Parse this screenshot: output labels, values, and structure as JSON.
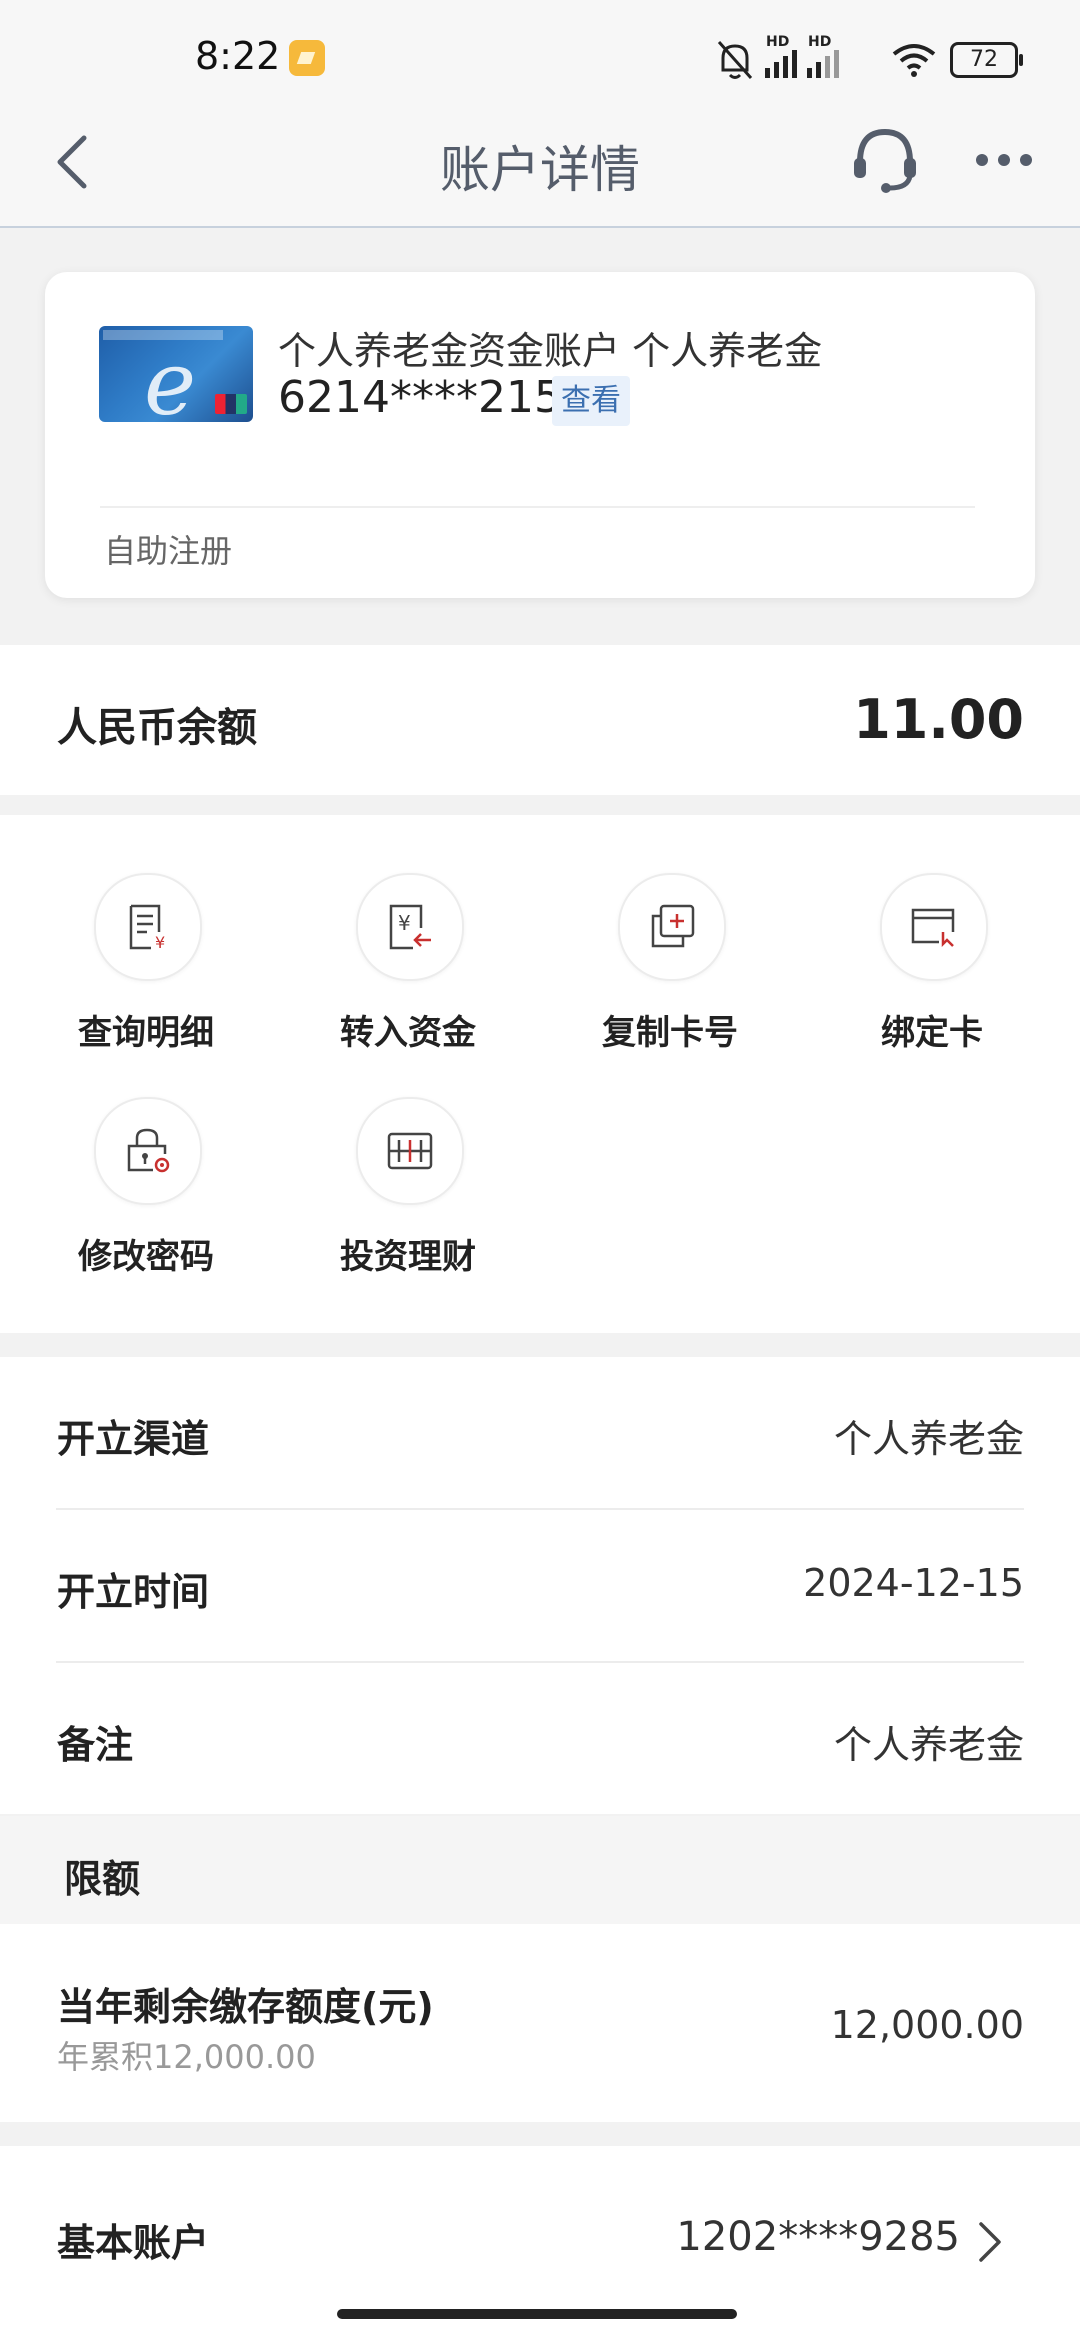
{
  "status_bar": {
    "time": "8:22",
    "battery": "72",
    "hd1": "HD",
    "hd2": "HD"
  },
  "nav": {
    "title": "账户详情"
  },
  "card": {
    "account_name": "个人养老金资金账户 个人养老金",
    "account_number": "6214****2157",
    "view_label": "查看",
    "registration": "自助注册"
  },
  "balance": {
    "label": "人民币余额",
    "value": "11.00"
  },
  "actions": [
    {
      "label": "查询明细",
      "icon": "statement-icon"
    },
    {
      "label": "转入资金",
      "icon": "transfer-in-icon"
    },
    {
      "label": "复制卡号",
      "icon": "copy-card-icon"
    },
    {
      "label": "绑定卡",
      "icon": "bind-card-icon"
    },
    {
      "label": "修改密码",
      "icon": "password-lock-icon"
    },
    {
      "label": "投资理财",
      "icon": "investment-icon"
    }
  ],
  "info": {
    "channel": {
      "label": "开立渠道",
      "value": "个人养老金"
    },
    "open_date": {
      "label": "开立时间",
      "value": "2024-12-15"
    },
    "remark": {
      "label": "备注",
      "value": "个人养老金"
    }
  },
  "limit": {
    "title": "限额",
    "quota_label": "当年剩余缴存额度(元)",
    "quota_sub": "年累积12,000.00",
    "quota_value": "12,000.00"
  },
  "basic_account": {
    "label": "基本账户",
    "value": "1202****9285"
  },
  "colors": {
    "accent_red": "#c8302f",
    "link_blue": "#3b6fb0",
    "nav_text": "#555d6b"
  }
}
